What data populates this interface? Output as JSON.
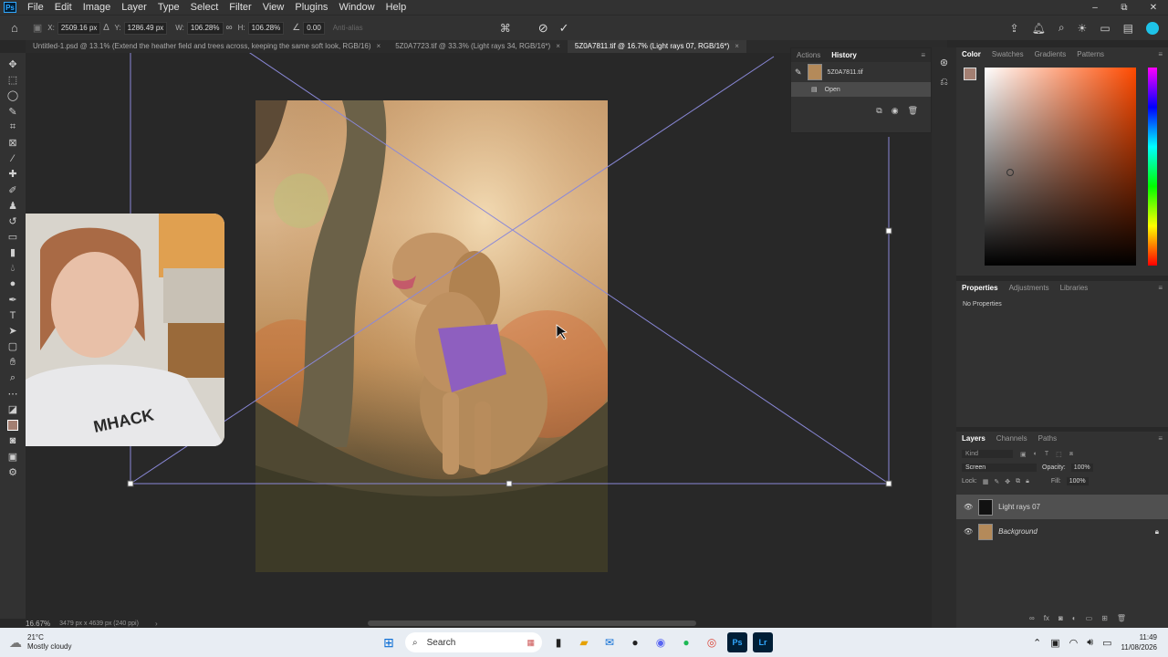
{
  "menubar": {
    "logo": "Ps",
    "items": [
      "File",
      "Edit",
      "Image",
      "Layer",
      "Type",
      "Select",
      "Filter",
      "View",
      "Plugins",
      "Window",
      "Help"
    ],
    "window_controls": [
      "–",
      "⧉",
      "✕"
    ]
  },
  "options": {
    "x_label": "X:",
    "x_value": "2509.16 px",
    "y_label": "Y:",
    "y_value": "1286.49 px",
    "w_label": "W:",
    "w_value": "106.28%",
    "h_label": "H:",
    "h_value": "106.28%",
    "angle_value": "0.00",
    "antialias": "Anti-alias"
  },
  "tabs": [
    {
      "label": "Untitled-1.psd @ 13.1% (Extend the heather field and trees across, keeping the same soft look, RGB/16)",
      "active": false
    },
    {
      "label": "5Z0A7723.tif @ 33.3% (Light rays 34, RGB/16*)",
      "active": false
    },
    {
      "label": "5Z0A7811.tif @ 16.7% (Light rays 07, RGB/16*)",
      "active": true
    }
  ],
  "history": {
    "tabs": [
      "Actions",
      "History"
    ],
    "snapshot_name": "5Z0A7811.tif",
    "steps": [
      "Open"
    ]
  },
  "color_panel": {
    "tabs": [
      "Color",
      "Swatches",
      "Gradients",
      "Patterns"
    ],
    "hue_color": "#ff4a00"
  },
  "properties_panel": {
    "tabs": [
      "Properties",
      "Adjustments",
      "Libraries"
    ],
    "empty_text": "No Properties"
  },
  "layers_panel": {
    "tabs": [
      "Layers",
      "Channels",
      "Paths"
    ],
    "kind_placeholder": "Kind",
    "blend_mode": "Screen",
    "opacity_label": "Opacity:",
    "opacity_value": "100%",
    "lock_label": "Lock:",
    "fill_label": "Fill:",
    "fill_value": "100%",
    "layers": [
      {
        "name": "Light rays 07",
        "visible": true,
        "selected": true
      },
      {
        "name": "Background",
        "visible": true,
        "selected": false,
        "locked": true
      }
    ]
  },
  "status": {
    "zoom": "16.67%",
    "doc_info": "3479 px x 4639 px (240 ppi)"
  },
  "taskbar": {
    "weather_temp": "21°C",
    "weather_desc": "Mostly cloudy",
    "search_placeholder": "Search",
    "time": "11:49",
    "date": "11/08/2026"
  }
}
